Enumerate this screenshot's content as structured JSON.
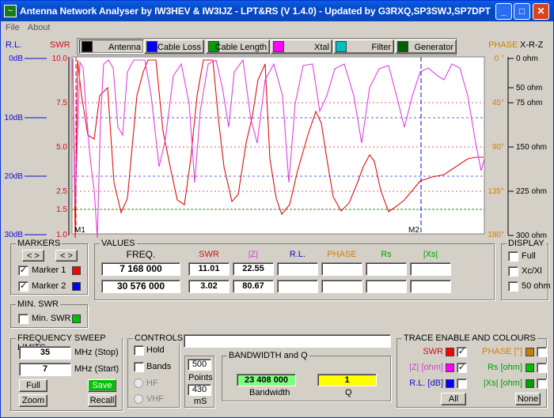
{
  "window": {
    "title": "Antenna Network Analyser by IW3HEV & IW3IJZ - LPT&RS (V 1.4.0) - Updated by G3RXQ,SP3SWJ,SP7DPT"
  },
  "menu": [
    "File",
    "About"
  ],
  "toolbar": [
    {
      "label": "Antenna",
      "swatch": "#000000",
      "icon": "antenna-icon"
    },
    {
      "label": "Cable Loss",
      "swatch": "#0000ff",
      "icon": "cable-loss-icon"
    },
    {
      "label": "Cable Length",
      "swatch": "#00a000",
      "icon": "cable-length-icon"
    },
    {
      "label": "Xtal",
      "swatch": "#ff00ff",
      "icon": "xtal-icon"
    },
    {
      "label": "Filter",
      "swatch": "#00c0c0",
      "icon": "filter-icon"
    },
    {
      "label": "Generator",
      "swatch": "#006000",
      "icon": "generator-icon"
    }
  ],
  "left_axes": {
    "rl_title": "R.L.",
    "swr_title": "SWR",
    "rl_ticks": [
      "0dB",
      "10dB",
      "20dB",
      "30dB"
    ],
    "swr_ticks": [
      "10.0",
      "7.5",
      "5.0",
      "2.5",
      "1.5",
      "1.0"
    ]
  },
  "right_axes": {
    "phase_title": "PHASE",
    "xrz_title": "X-R-Z",
    "phase_ticks": [
      "0 °",
      "45°",
      "90°",
      "135°",
      "180°"
    ],
    "ohm_ticks": [
      "0 ohm",
      "50 ohm",
      "75 ohm",
      "150 ohm",
      "225 ohm",
      "300 ohm"
    ]
  },
  "plot": {
    "marker1": "M1",
    "marker2": "M2"
  },
  "markers": {
    "title": "MARKERS",
    "m1": "Marker 1",
    "m2": "Marker 2",
    "m1_color": "#ff0000",
    "m2_color": "#0000ff"
  },
  "values": {
    "title": "VALUES",
    "headers": [
      "FREQ.",
      "SWR",
      "|Z|",
      "R.L.",
      "PHASE",
      "Rs",
      "|Xs|"
    ],
    "rows": [
      [
        "7 168 000",
        "11.01",
        "22.55",
        "",
        "",
        "",
        ""
      ],
      [
        "30 576 000",
        "3.02",
        "80.67",
        "",
        "",
        "",
        ""
      ]
    ]
  },
  "display": {
    "title": "DISPLAY",
    "opts": [
      "Full",
      "Xc/Xl",
      "50 ohm"
    ]
  },
  "minswr": {
    "title": "MIN. SWR",
    "label": "Min. SWR"
  },
  "sweep": {
    "title": "FREQUENCY SWEEP LIMITS",
    "stop": "35",
    "stop_label": "MHz (Stop)",
    "start": "7",
    "start_label": "MHz (Start)",
    "full": "Full",
    "save": "Save",
    "zoom": "Zoom",
    "recall": "Recall"
  },
  "controls": {
    "title": "CONTROLS",
    "hold": "Hold",
    "bands": "Bands",
    "hf": "HF",
    "vhf": "VHF",
    "points": "500",
    "points_label": "Points",
    "ms": "430",
    "ms_label": "mS"
  },
  "bandwidth": {
    "title": "BANDWIDTH and Q",
    "value": "23 408 000",
    "bw_label": "Bandwidth",
    "q": "1",
    "q_label": "Q"
  },
  "trace": {
    "title": "TRACE ENABLE AND COLOURS",
    "items": [
      {
        "label": "SWR",
        "color": "#ff0000",
        "checked": "✓"
      },
      {
        "label": "|Z| [ohm]",
        "color": "#ff00ff",
        "checked": "✓"
      },
      {
        "label": "R.L. [dB]",
        "color": "#0000ff",
        "checked": ""
      },
      {
        "label": "PHASE [°]",
        "color": "#c08000",
        "checked": ""
      },
      {
        "label": "Rs [ohm]",
        "color": "#00c000",
        "checked": ""
      },
      {
        "label": "|Xs| [ohm]",
        "color": "#00a000",
        "checked": ""
      }
    ],
    "all": "All",
    "none": "None"
  }
}
